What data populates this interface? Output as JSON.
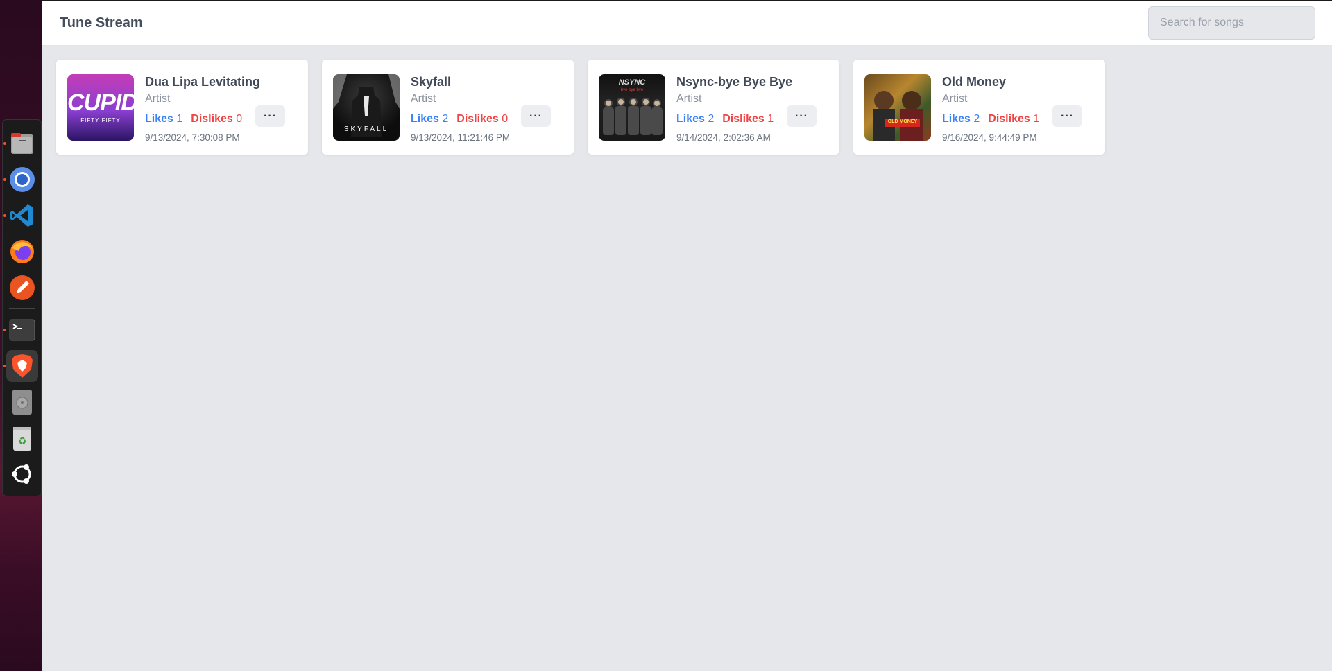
{
  "app": {
    "title": "Tune Stream"
  },
  "search": {
    "placeholder": "Search for songs"
  },
  "colors": {
    "likes": "#3b82f6",
    "dislikes": "#ef4444",
    "background": "#e5e7eb"
  },
  "songs": [
    {
      "title": "Dua Lipa Levitating",
      "artist": "Artist",
      "likes_label": "Likes",
      "likes": "1",
      "dislikes_label": "Dislikes",
      "dislikes": "0",
      "date": "9/13/2024, 7:30:08 PM",
      "more": "···",
      "cover_text": "CUPID",
      "cover_subtext": "FIFTY FIFTY"
    },
    {
      "title": "Skyfall",
      "artist": "Artist",
      "likes_label": "Likes",
      "likes": "2",
      "dislikes_label": "Dislikes",
      "dislikes": "0",
      "date": "9/13/2024, 11:21:46 PM",
      "more": "···",
      "cover_text": "SKYFALL"
    },
    {
      "title": "Nsync-bye Bye Bye",
      "artist": "Artist",
      "likes_label": "Likes",
      "likes": "2",
      "dislikes_label": "Dislikes",
      "dislikes": "1",
      "date": "9/14/2024, 2:02:36 AM",
      "more": "···",
      "cover_text": "NSYNC",
      "cover_subtext": "bye bye bye"
    },
    {
      "title": "Old Money",
      "artist": "Artist",
      "likes_label": "Likes",
      "likes": "2",
      "dislikes_label": "Dislikes",
      "dislikes": "1",
      "date": "9/16/2024, 9:44:49 PM",
      "more": "···",
      "cover_text": "OLD MONEY"
    }
  ],
  "dock": {
    "items": [
      "files-icon",
      "chromium-icon",
      "vscode-icon",
      "firefox-icon",
      "text-editor-icon",
      "terminal-icon",
      "brave-icon",
      "disk-icon",
      "trash-icon",
      "ubuntu-icon"
    ]
  }
}
